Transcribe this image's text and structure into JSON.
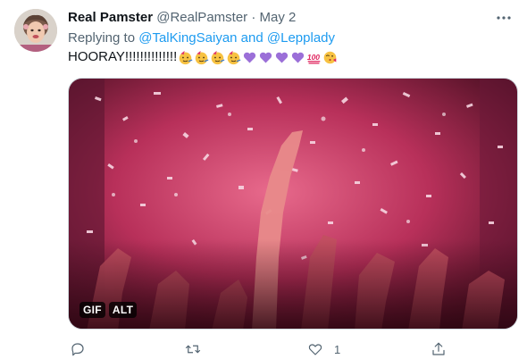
{
  "tweet": {
    "display_name": "Real Pamster",
    "handle": "@RealPamster",
    "separator": "·",
    "date": "May 2",
    "replying_prefix": "Replying to ",
    "reply_mention_1": "@TalKingSaiyan",
    "reply_and": " and ",
    "reply_mention_2": "@Lepplady",
    "text": "HOORAY!!!!!!!!!!!!!!",
    "emojis": [
      "partying-face",
      "partying-face",
      "partying-face",
      "partying-face",
      "purple-heart",
      "purple-heart",
      "purple-heart",
      "purple-heart",
      "hundred-points",
      "face-blowing-kiss"
    ]
  },
  "media": {
    "type": "gif",
    "badge_gif": "GIF",
    "badge_alt": "ALT",
    "dominant_color": "#c2406a"
  },
  "actions": {
    "reply_icon": "reply-icon",
    "retweet_icon": "retweet-icon",
    "like_icon": "heart-icon",
    "like_count": "1",
    "share_icon": "share-icon"
  },
  "colors": {
    "link": "#1d9bf0",
    "secondary_text": "#536471",
    "primary_text": "#0f1419"
  }
}
